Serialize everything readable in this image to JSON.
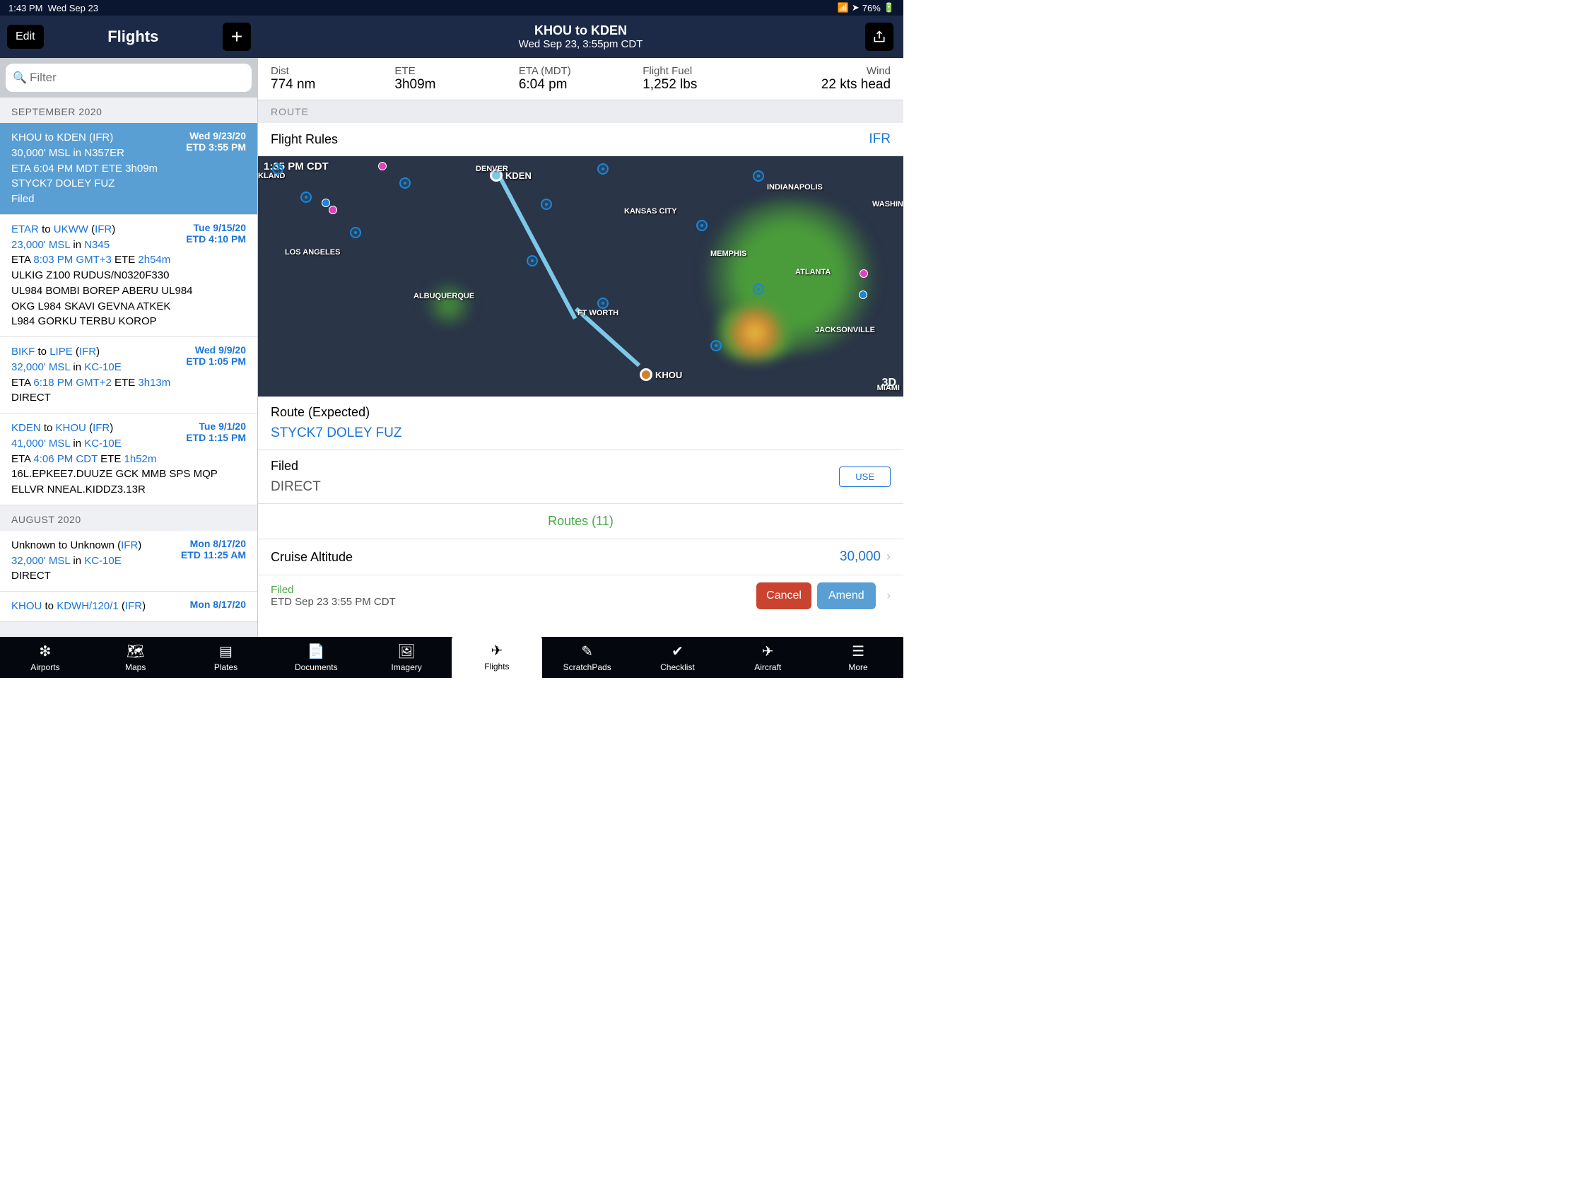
{
  "status": {
    "time": "1:43 PM",
    "date": "Wed Sep 23",
    "battery": "76%"
  },
  "header": {
    "edit": "Edit",
    "title": "Flights",
    "route_main": "KHOU to KDEN",
    "route_sub": "Wed Sep 23, 3:55pm CDT"
  },
  "filter": {
    "placeholder": "Filter"
  },
  "sections": [
    {
      "title": "SEPTEMBER 2020"
    },
    {
      "title": "AUGUST 2020"
    }
  ],
  "flights": [
    {
      "selected": true,
      "l1a": "KHOU",
      "l1b": " to ",
      "l1c": "KDEN",
      "l1d": " (",
      "l1e": "IFR",
      "l1f": ")",
      "l2a": "30,000' MSL",
      "l2b": " in ",
      "l2c": "N357ER",
      "l3a": "ETA ",
      "l3b": "6:04 PM MDT",
      "l3c": " ETE ",
      "l3d": "3h09m",
      "l4": "STYCK7 DOLEY FUZ",
      "l5": "Filed",
      "date1": "Wed 9/23/20",
      "date2": "ETD 3:55 PM"
    },
    {
      "l1a": "ETAR",
      "l1b": " to ",
      "l1c": "UKWW",
      "l1d": " (",
      "l1e": "IFR",
      "l1f": ")",
      "l2a": "23,000' MSL",
      "l2b": " in ",
      "l2c": "N345",
      "l3a": "ETA ",
      "l3b": "8:03 PM GMT+3",
      "l3c": " ETE ",
      "l3d": "2h54m",
      "l4": "ULKIG Z100 RUDUS/N0320F330 UL984 BOMBI BOREP ABERU UL984 OKG L984 SKAVI GEVNA ATKEK L984 GORKU TERBU KOROP",
      "date1": "Tue 9/15/20",
      "date2": "ETD 4:10 PM"
    },
    {
      "l1a": "BIKF",
      "l1b": " to ",
      "l1c": "LIPE",
      "l1d": " (",
      "l1e": "IFR",
      "l1f": ")",
      "l2a": "32,000' MSL",
      "l2b": " in ",
      "l2c": "KC-10E",
      "l3a": "ETA ",
      "l3b": "6:18 PM GMT+2",
      "l3c": " ETE ",
      "l3d": "3h13m",
      "l4": "DIRECT",
      "date1": "Wed 9/9/20",
      "date2": "ETD 1:05 PM"
    },
    {
      "l1a": "KDEN",
      "l1b": " to ",
      "l1c": "KHOU",
      "l1d": " (",
      "l1e": "IFR",
      "l1f": ")",
      "l2a": "41,000' MSL",
      "l2b": " in ",
      "l2c": "KC-10E",
      "l3a": "ETA ",
      "l3b": "4:06 PM CDT",
      "l3c": " ETE ",
      "l3d": "1h52m",
      "l4": "16L.EPKEE7.DUUZE GCK MMB SPS MQP ELLVR NNEAL.KIDDZ3.13R",
      "date1": "Tue 9/1/20",
      "date2": "ETD 1:15 PM"
    },
    {
      "l1a": "Unknown",
      "l1b": " to ",
      "l1c": "Unknown",
      "l1d": " (",
      "l1e": "IFR",
      "l1f": ")",
      "l2a": "32,000' MSL",
      "l2b": " in ",
      "l2c": "KC-10E",
      "l4": "DIRECT",
      "date1": "Mon 8/17/20",
      "date2": "ETD 11:25 AM"
    },
    {
      "l1a": "KHOU",
      "l1b": " to ",
      "l1c": "KDWH/120/1",
      "l1d": " (",
      "l1e": "IFR",
      "l1f": ")",
      "date1": "Mon 8/17/20"
    }
  ],
  "stats": {
    "dist_l": "Dist",
    "dist_v": "774 nm",
    "ete_l": "ETE",
    "ete_v": "3h09m",
    "eta_l": "ETA (MDT)",
    "eta_v": "6:04 pm",
    "fuel_l": "Flight Fuel",
    "fuel_v": "1,252 lbs",
    "wind_l": "Wind",
    "wind_v": "22 kts head"
  },
  "route_section": "ROUTE",
  "flight_rules": {
    "label": "Flight Rules",
    "value": "IFR"
  },
  "map": {
    "time": "1:35 PM CDT",
    "btn_3d": "3D",
    "kden": "KDEN",
    "khou": "KHOU",
    "cities": {
      "denver": "DENVER",
      "kland": "KLAND",
      "la": "LOS ANGELES",
      "abq": "ALBUQUERQUE",
      "kc": "KANSAS CITY",
      "indy": "INDIANAPOLIS",
      "washin": "WASHIN",
      "memphis": "MEMPHIS",
      "atlanta": "ATLANTA",
      "ftworth": "FT WORTH",
      "jax": "JACKSONVILLE",
      "miami": "MIAMI"
    }
  },
  "route_expected": {
    "label": "Route (Expected)",
    "value": "STYCK7 DOLEY FUZ"
  },
  "filed": {
    "label": "Filed",
    "value": "DIRECT",
    "use": "USE"
  },
  "routes_link": "Routes (11)",
  "cruise": {
    "label": "Cruise Altitude",
    "value": "30,000"
  },
  "filed_bar": {
    "status": "Filed",
    "time": "ETD Sep 23 3:55 PM CDT",
    "cancel": "Cancel",
    "amend": "Amend"
  },
  "tabs": {
    "airports": "Airports",
    "maps": "Maps",
    "plates": "Plates",
    "documents": "Documents",
    "imagery": "Imagery",
    "flights": "Flights",
    "scratchpads": "ScratchPads",
    "checklist": "Checklist",
    "aircraft": "Aircraft",
    "more": "More"
  }
}
